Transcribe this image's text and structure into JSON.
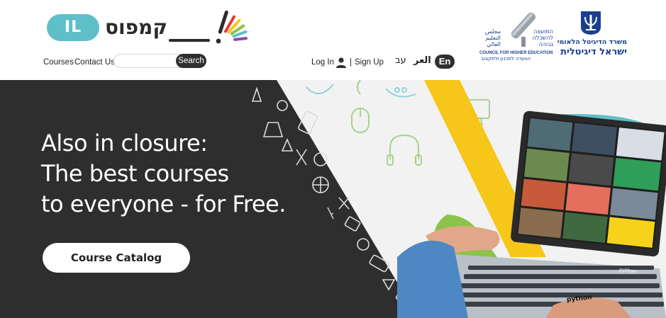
{
  "header": {
    "logo": {
      "badge": "IL",
      "wordmark": "קמפוס"
    },
    "nav": {
      "courses": "Courses",
      "contact": "Contact Us"
    },
    "search": {
      "placeholder": "",
      "button": "Search"
    },
    "account": {
      "login": "Log In",
      "separator": "|",
      "signup": "Sign Up"
    },
    "languages": {
      "hebrew": "עב",
      "arabic": "العر",
      "english": "En"
    },
    "che_logo": {
      "arabic": "مجلس التعليم العالي",
      "hebrew": "המועצה להשכלה גבוהה",
      "english": "COUNCIL FOR HIGHER EDUCATION",
      "hebrew_sub": "הוועדה לתכנון ולתקצוב"
    },
    "gov_logo": {
      "line1": "משרד הדיגיטל הלאומי",
      "line2": "ישראל דיגיטלית"
    }
  },
  "hero": {
    "lines": [
      "Also in closure:",
      "The best courses",
      "to everyone - for Free."
    ],
    "cta": "Course Catalog",
    "laptop_tiles": {
      "python": "python",
      "bottom": "python"
    }
  },
  "colors": {
    "hero_dark": "#2e2e2e",
    "accent_yellow": "#f6c619",
    "accent_green": "#8cc34a",
    "accent_teal": "#5fbfc9",
    "brand_blue": "#1b3f8f"
  }
}
